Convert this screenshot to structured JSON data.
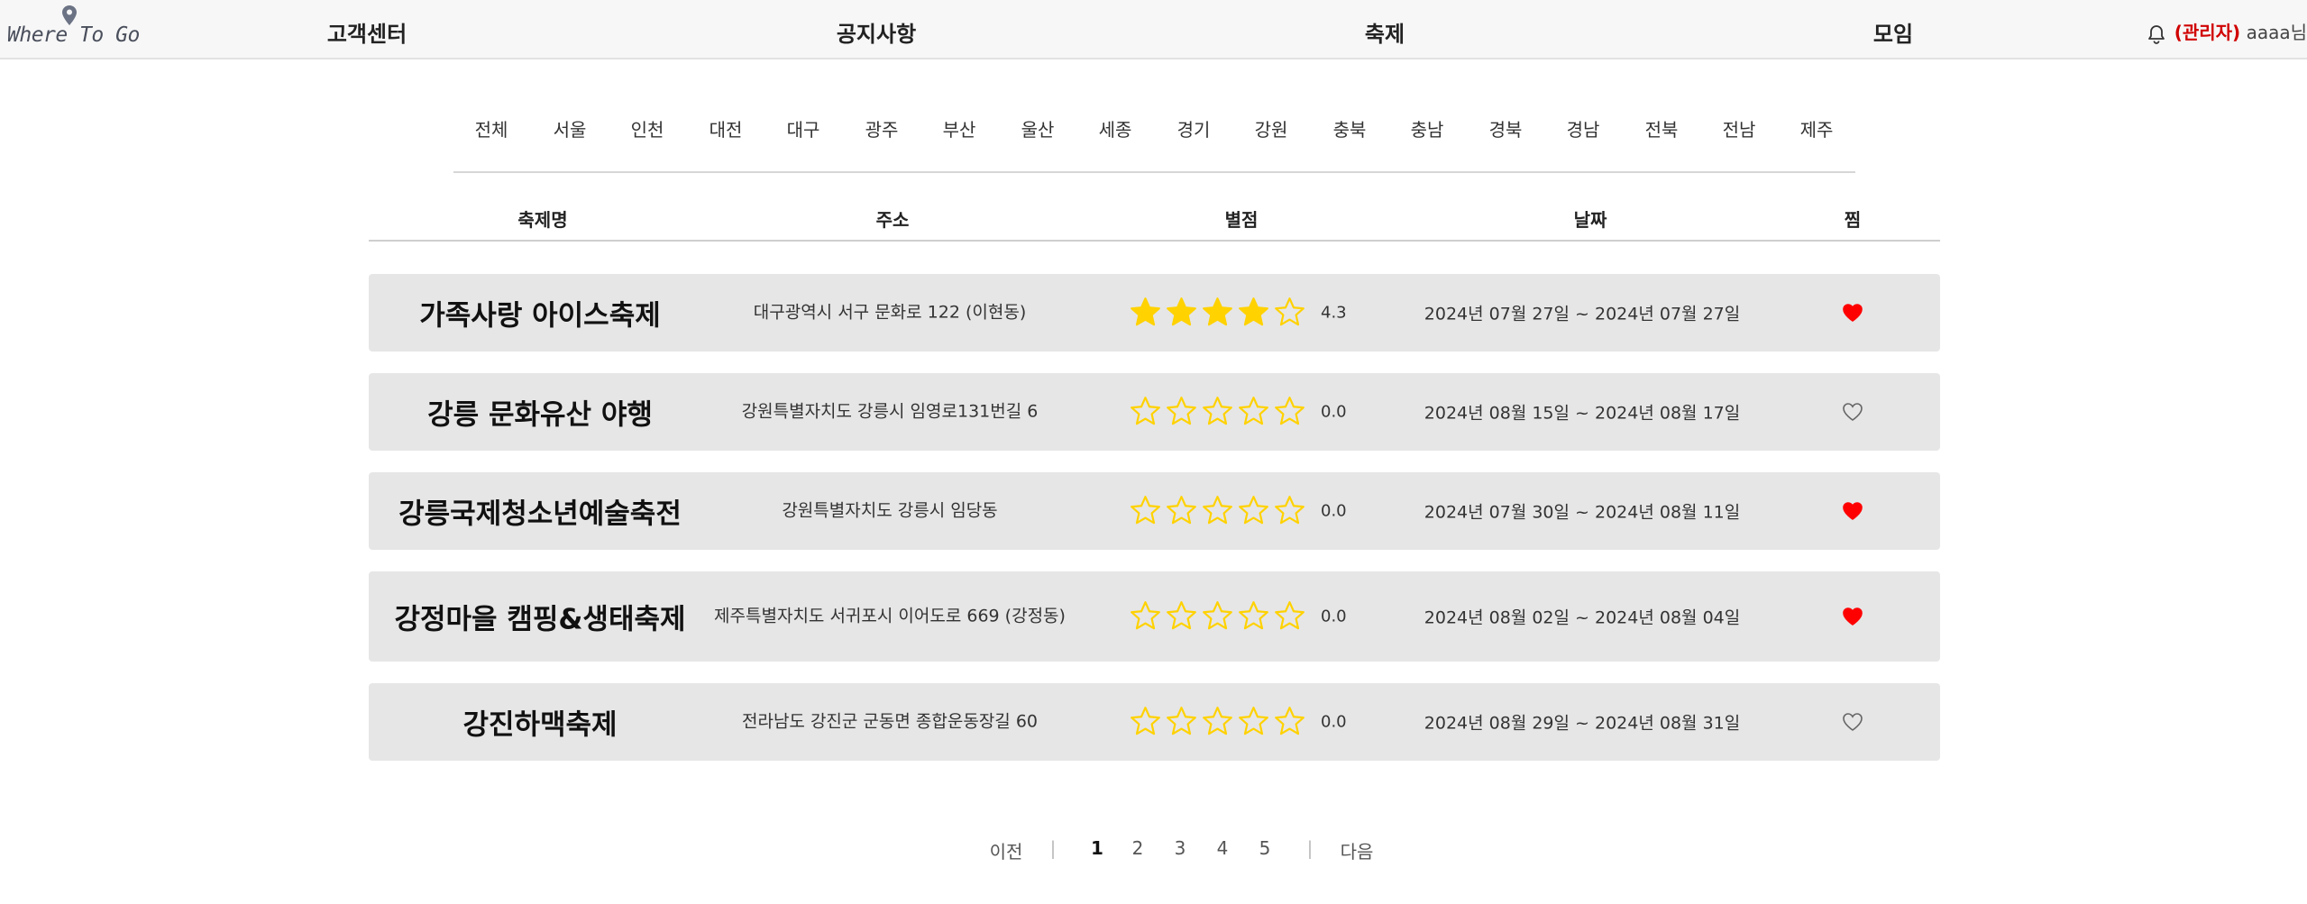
{
  "header": {
    "logo_text": "Where To Go",
    "nav": [
      "고객센터",
      "공지사항",
      "축제",
      "모임"
    ],
    "user": {
      "admin_label": "(관리자)",
      "username": "aaaa",
      "suffix": "님"
    }
  },
  "regions": [
    "전체",
    "서울",
    "인천",
    "대전",
    "대구",
    "광주",
    "부산",
    "울산",
    "세종",
    "경기",
    "강원",
    "충북",
    "충남",
    "경북",
    "경남",
    "전북",
    "전남",
    "제주"
  ],
  "table": {
    "columns": [
      "축제명",
      "주소",
      "별점",
      "날짜",
      "찜"
    ],
    "rows": [
      {
        "name": "가족사랑 아이스축제",
        "address": "대구광역시 서구 문화로 122 (이현동)",
        "stars": 4,
        "rating": "4.3",
        "date": "2024년 07월 27일 ~ 2024년 07월 27일",
        "liked": true
      },
      {
        "name": "강릉 문화유산 야행",
        "address": "강원특별자치도 강릉시 임영로131번길 6",
        "stars": 0,
        "rating": "0.0",
        "date": "2024년 08월 15일 ~ 2024년 08월 17일",
        "liked": false
      },
      {
        "name": "강릉국제청소년예술축전",
        "address": "강원특별자치도 강릉시 임당동",
        "stars": 0,
        "rating": "0.0",
        "date": "2024년 07월 30일 ~ 2024년 08월 11일",
        "liked": true
      },
      {
        "name": "강정마을 캠핑&생태축제",
        "address": "제주특별자치도 서귀포시 이어도로 669 (강정동)",
        "stars": 0,
        "rating": "0.0",
        "date": "2024년 08월 02일 ~ 2024년 08월 04일",
        "liked": true
      },
      {
        "name": "강진하맥축제",
        "address": "전라남도 강진군 군동면 종합운동장길 60",
        "stars": 0,
        "rating": "0.0",
        "date": "2024년 08월 29일 ~ 2024년 08월 31일",
        "liked": false
      }
    ]
  },
  "pagination": {
    "prev": "이전",
    "next": "다음",
    "pages": [
      "1",
      "2",
      "3",
      "4",
      "5"
    ],
    "current": "1"
  },
  "colors": {
    "accent_red": "#ff0000",
    "star_yellow": "#ffd200",
    "row_bg": "#e6e6e6",
    "admin_red": "#d00000"
  }
}
